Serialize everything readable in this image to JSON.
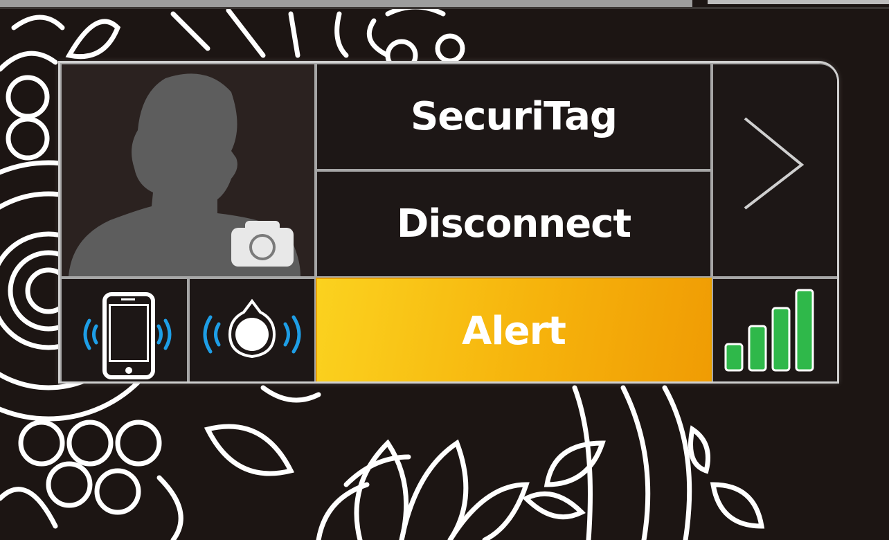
{
  "app": {
    "title": "SecuriTag",
    "disconnect_label": "Disconnect",
    "alert_label": "Alert"
  },
  "icons": {
    "profile": "person-silhouette-icon",
    "camera": "camera-icon",
    "phone": "phone-ringing-icon",
    "tag": "tag-ringing-icon",
    "next": "chevron-right-icon",
    "signal": "signal-strength-icon"
  },
  "signal": {
    "level": 4,
    "max": 4
  },
  "colors": {
    "background": "#1c1513",
    "alert_start": "#fbd21f",
    "alert_end": "#f09c04",
    "signal_green": "#2fb84a",
    "wave_blue": "#1e9ee6"
  }
}
